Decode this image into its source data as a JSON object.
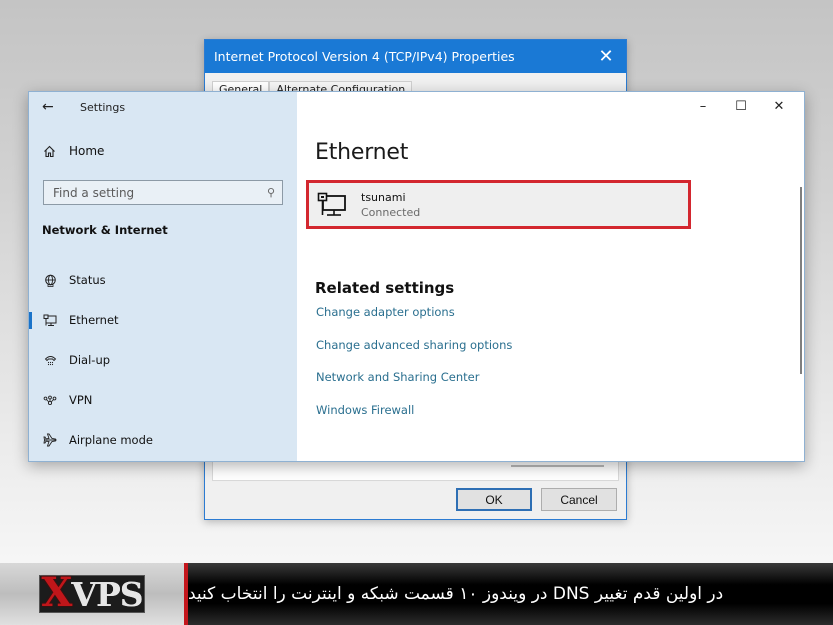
{
  "ipv4_dialog": {
    "title": "Internet Protocol Version 4 (TCP/IPv4) Properties",
    "close_icon": "close-icon",
    "tabs": [
      {
        "label": "General",
        "active": true
      },
      {
        "label": "Alternate Configuration",
        "active": false
      }
    ],
    "ok_label": "OK",
    "cancel_label": "Cancel"
  },
  "settings": {
    "window_title": "Settings",
    "back_icon": "back-arrow-icon",
    "home_label": "Home",
    "search_placeholder": "Find a setting",
    "section_title": "Network & Internet",
    "nav": [
      {
        "label": "Status",
        "icon": "globe-status-icon",
        "active": false
      },
      {
        "label": "Ethernet",
        "icon": "ethernet-icon",
        "active": true
      },
      {
        "label": "Dial-up",
        "icon": "phone-icon",
        "active": false
      },
      {
        "label": "VPN",
        "icon": "vpn-icon",
        "active": false
      },
      {
        "label": "Airplane mode",
        "icon": "airplane-icon",
        "active": false
      }
    ],
    "window_controls": {
      "minimize": "–",
      "maximize": "☐",
      "close": "✕"
    },
    "page_title": "Ethernet",
    "connection": {
      "name": "tsunami",
      "status": "Connected",
      "highlight_color": "#d3272f"
    },
    "related_title": "Related settings",
    "related_links": [
      "Change adapter options",
      "Change advanced sharing options",
      "Network and Sharing Center",
      "Windows Firewall"
    ]
  },
  "banner": {
    "logo_x": "X",
    "logo_vps": "VPS",
    "caption": "در اولین قدم تغییر DNS در ویندوز ۱۰ قسمت شبکه و اینترنت را انتخاب کنید",
    "accent_color": "#c4161c"
  }
}
